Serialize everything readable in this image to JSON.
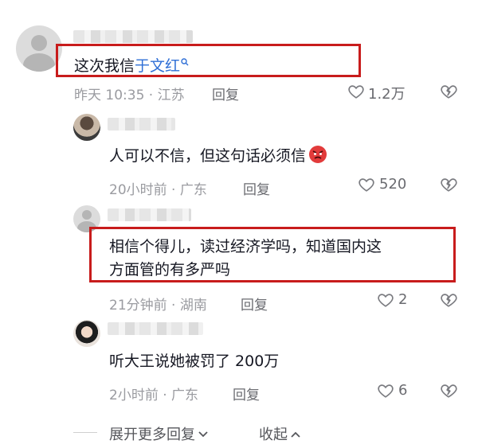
{
  "comments": [
    {
      "text_plain": "这次我信",
      "text_link": "于文红",
      "time": "昨天 10:35 · 江苏",
      "reply_label": "回复",
      "likes": "1.2万"
    },
    {
      "text": "人可以不信，但这句话必须信",
      "time": "20小时前 · 广东",
      "reply_label": "回复",
      "likes": "520"
    },
    {
      "text_line1": "相信个得儿，读过经济学吗，知道国内这",
      "text_line2": "方面管的有多严吗",
      "time": "21分钟前 · 湖南",
      "reply_label": "回复",
      "likes": "2"
    },
    {
      "text": "听大王说她被罚了 200万",
      "time": "2小时前 · 广东",
      "reply_label": "回复",
      "likes": "6"
    }
  ],
  "footer": {
    "expand_label": "展开更多回复",
    "collapse_label": "收起"
  },
  "colors": {
    "link": "#2f6fd6",
    "highlight_box": "#c81c1c",
    "meta": "#9a9ba0"
  },
  "icons": [
    "search-icon",
    "heart-icon",
    "broken-heart-icon",
    "angry-emoji-icon",
    "chevron-down-icon",
    "chevron-up-icon"
  ]
}
